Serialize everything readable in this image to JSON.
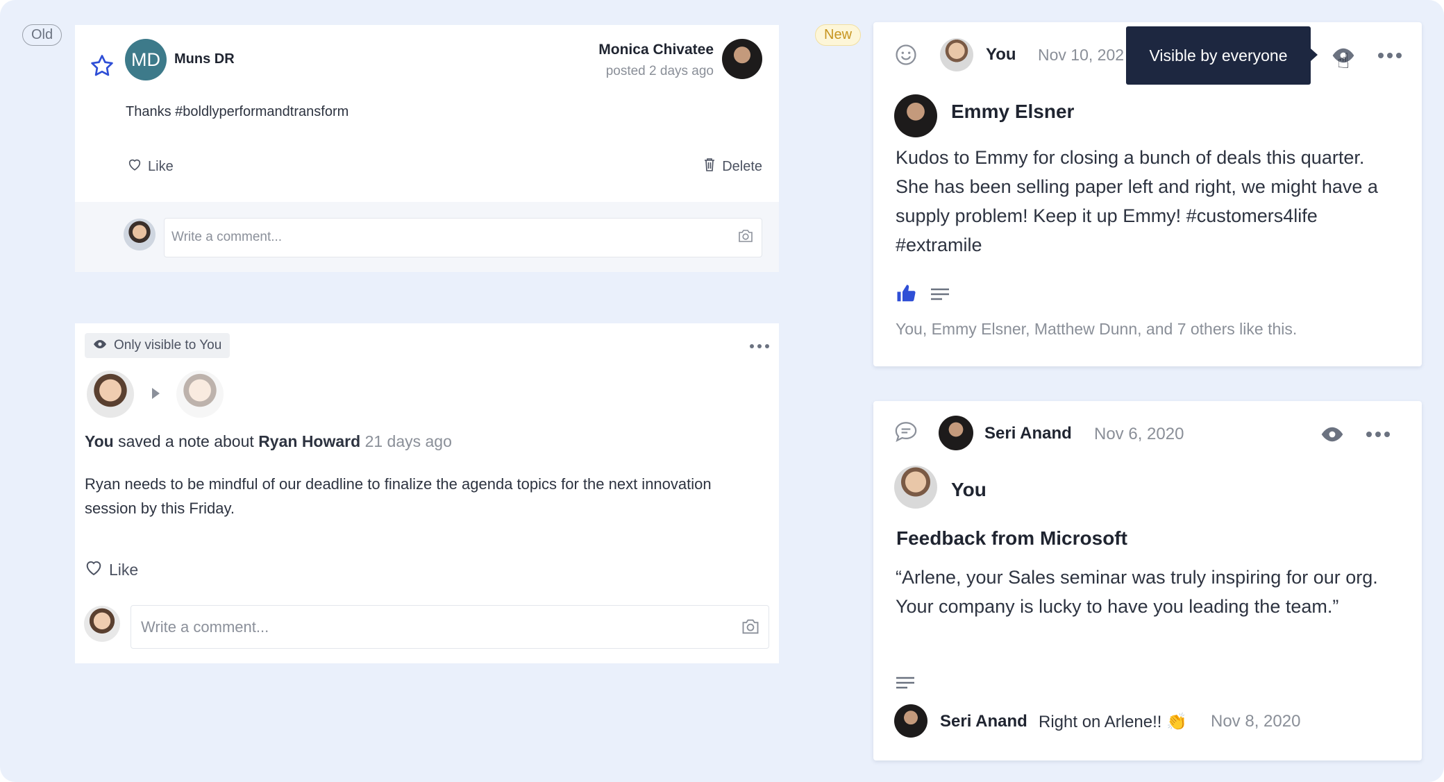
{
  "labels": {
    "old": "Old",
    "new": "New"
  },
  "old_post": {
    "author_initials": "MD",
    "author_name": "Muns DR",
    "poster_name": "Monica Chivatee",
    "posted_time": "posted 2 days ago",
    "body": "Thanks #boldlyperformandtransform",
    "like_label": "Like",
    "delete_label": "Delete",
    "comment_placeholder": "Write a comment..."
  },
  "old_note": {
    "visibility_label": "Only visible to You",
    "actor": "You",
    "action_text": "saved a note about",
    "subject": "Ryan Howard",
    "time": "21 days ago",
    "body": "Ryan needs to be mindful of our deadline to finalize the agenda topics for the next innovation session by this Friday.",
    "like_label": "Like",
    "comment_placeholder": "Write a comment..."
  },
  "new_post": {
    "author": "You",
    "date": "Nov 10, 202",
    "tooltip": "Visible by everyone",
    "recipient": "Emmy Elsner",
    "body": "Kudos to Emmy for closing a bunch of deals this quarter. She has been selling paper left and right, we might have a supply problem! Keep it up Emmy! #customers4life #extramile",
    "likes_summary": "You, Emmy Elsner, Matthew Dunn, and 7 others like this."
  },
  "new_feedback": {
    "author": "Seri Anand",
    "date": "Nov 6, 2020",
    "recipient": "You",
    "title": "Feedback from Microsoft",
    "body": "“Arlene, your Sales seminar was truly inspiring for our org. Your company is lucky to have you leading the team.”",
    "reply_author": "Seri Anand",
    "reply_text": "Right on Arlene!! 👏",
    "reply_date": "Nov 8, 2020"
  },
  "colors": {
    "accent": "#2f4fd6",
    "tooltip_bg": "#1d2740",
    "new_tag_text": "#c79520"
  }
}
